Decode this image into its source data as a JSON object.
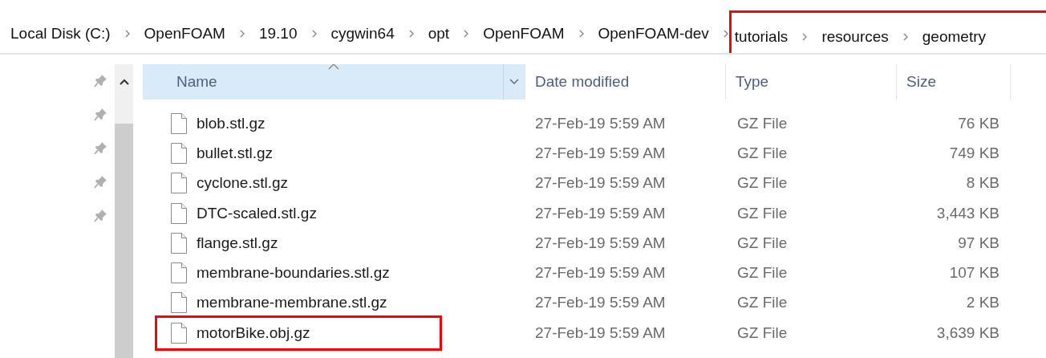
{
  "breadcrumb": [
    {
      "label": "Local Disk (C:)",
      "highlighted": false
    },
    {
      "label": "OpenFOAM",
      "highlighted": false
    },
    {
      "label": "19.10",
      "highlighted": false
    },
    {
      "label": "cygwin64",
      "highlighted": false
    },
    {
      "label": "opt",
      "highlighted": false
    },
    {
      "label": "OpenFOAM",
      "highlighted": false
    },
    {
      "label": "OpenFOAM-dev",
      "highlighted": false
    },
    {
      "label": "tutorials",
      "highlighted": true
    },
    {
      "label": "resources",
      "highlighted": true
    },
    {
      "label": "geometry",
      "highlighted": true
    }
  ],
  "columns": [
    {
      "label": "Name",
      "sorted": true
    },
    {
      "label": "Date modified",
      "sorted": false
    },
    {
      "label": "Type",
      "sorted": false
    },
    {
      "label": "Size",
      "sorted": false
    }
  ],
  "rows": [
    {
      "name": "blob.stl.gz",
      "date": "27-Feb-19 5:59 AM",
      "type": "GZ File",
      "size": "76 KB",
      "highlighted": false
    },
    {
      "name": "bullet.stl.gz",
      "date": "27-Feb-19 5:59 AM",
      "type": "GZ File",
      "size": "749 KB",
      "highlighted": false
    },
    {
      "name": "cyclone.stl.gz",
      "date": "27-Feb-19 5:59 AM",
      "type": "GZ File",
      "size": "8 KB",
      "highlighted": false
    },
    {
      "name": "DTC-scaled.stl.gz",
      "date": "27-Feb-19 5:59 AM",
      "type": "GZ File",
      "size": "3,443 KB",
      "highlighted": false
    },
    {
      "name": "flange.stl.gz",
      "date": "27-Feb-19 5:59 AM",
      "type": "GZ File",
      "size": "97 KB",
      "highlighted": false
    },
    {
      "name": "membrane-boundaries.stl.gz",
      "date": "27-Feb-19 5:59 AM",
      "type": "GZ File",
      "size": "107 KB",
      "highlighted": false
    },
    {
      "name": "membrane-membrane.stl.gz",
      "date": "27-Feb-19 5:59 AM",
      "type": "GZ File",
      "size": "2 KB",
      "highlighted": false
    },
    {
      "name": "motorBike.obj.gz",
      "date": "27-Feb-19 5:59 AM",
      "type": "GZ File",
      "size": "3,639 KB",
      "highlighted": true
    }
  ]
}
